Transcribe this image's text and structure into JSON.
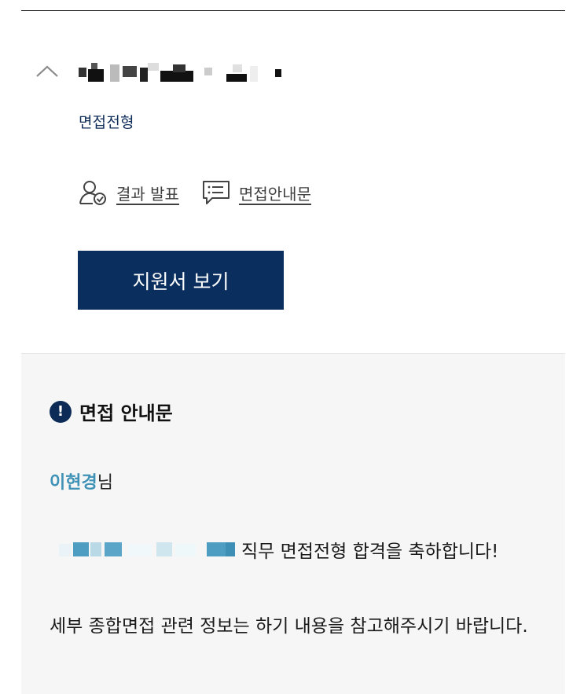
{
  "application": {
    "stage": "면접전형",
    "links": [
      {
        "label": "결과 발표",
        "icon": "user-check-icon"
      },
      {
        "label": "면접안내문",
        "icon": "message-list-icon"
      }
    ],
    "view_button_label": "지원서 보기",
    "title_redacted": true
  },
  "notice": {
    "heading": "면접 안내문",
    "icon": "exclamation-circle-icon",
    "greeting_name": "이현경",
    "greeting_suffix": "님",
    "congrats_text": "직무 면접전형 합격을 축하합니다!",
    "detail_text": "세부 종합면접 관련 정보는 하기 내용을 참고해주시기 바랍니다.",
    "job_title_redacted": true
  },
  "colors": {
    "button_bg": "#0a2f5e",
    "stage_text": "#0f2d59",
    "name_accent": "#3f92b6",
    "panel_bg": "#f6f6f6"
  }
}
